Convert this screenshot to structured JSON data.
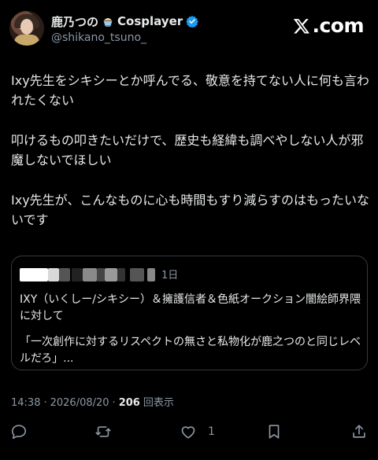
{
  "header": {
    "display_name": "鹿乃つの",
    "name_suffix": "Cosplayer",
    "emoji_name": "shaved-ice-emoji",
    "handle": "@shikano_tsuno_",
    "brand_text": ".com",
    "brand_icon": "x-logo-icon"
  },
  "tweet": {
    "paragraphs": [
      "Ixy先生をシキシーとか呼んでる、敬意を持てない人に何も言われたくない",
      "叩けるもの叩きたいだけで、歴史も経緯も調べやしない人が邪魔しないでほしい",
      "Ixy先生が、こんなものに心も時間もすり減らすのはもったいないです"
    ]
  },
  "quote": {
    "time": "1日",
    "text_1": "IXY（いくしー/シキシー）＆擁護信者＆色紙オークション闇絵師界隈に対して",
    "text_2": "「一次創作に対するリスペクトの無さと私物化が鹿之つのと同じレベルだろ」..."
  },
  "meta": {
    "time": "14:38",
    "sep1": "·",
    "date": "2026/08/20",
    "sep2": "·",
    "views": "206",
    "views_label": "回表示"
  },
  "actions": {
    "like_count": "1",
    "icons": [
      "reply-icon",
      "retweet-icon",
      "like-icon",
      "bookmark-icon",
      "share-icon"
    ]
  },
  "colors": {
    "background": "#000000",
    "text": "#e7e9ea",
    "muted": "#8b98a5",
    "verified": "#1d9bf0",
    "border": "#333a40"
  }
}
